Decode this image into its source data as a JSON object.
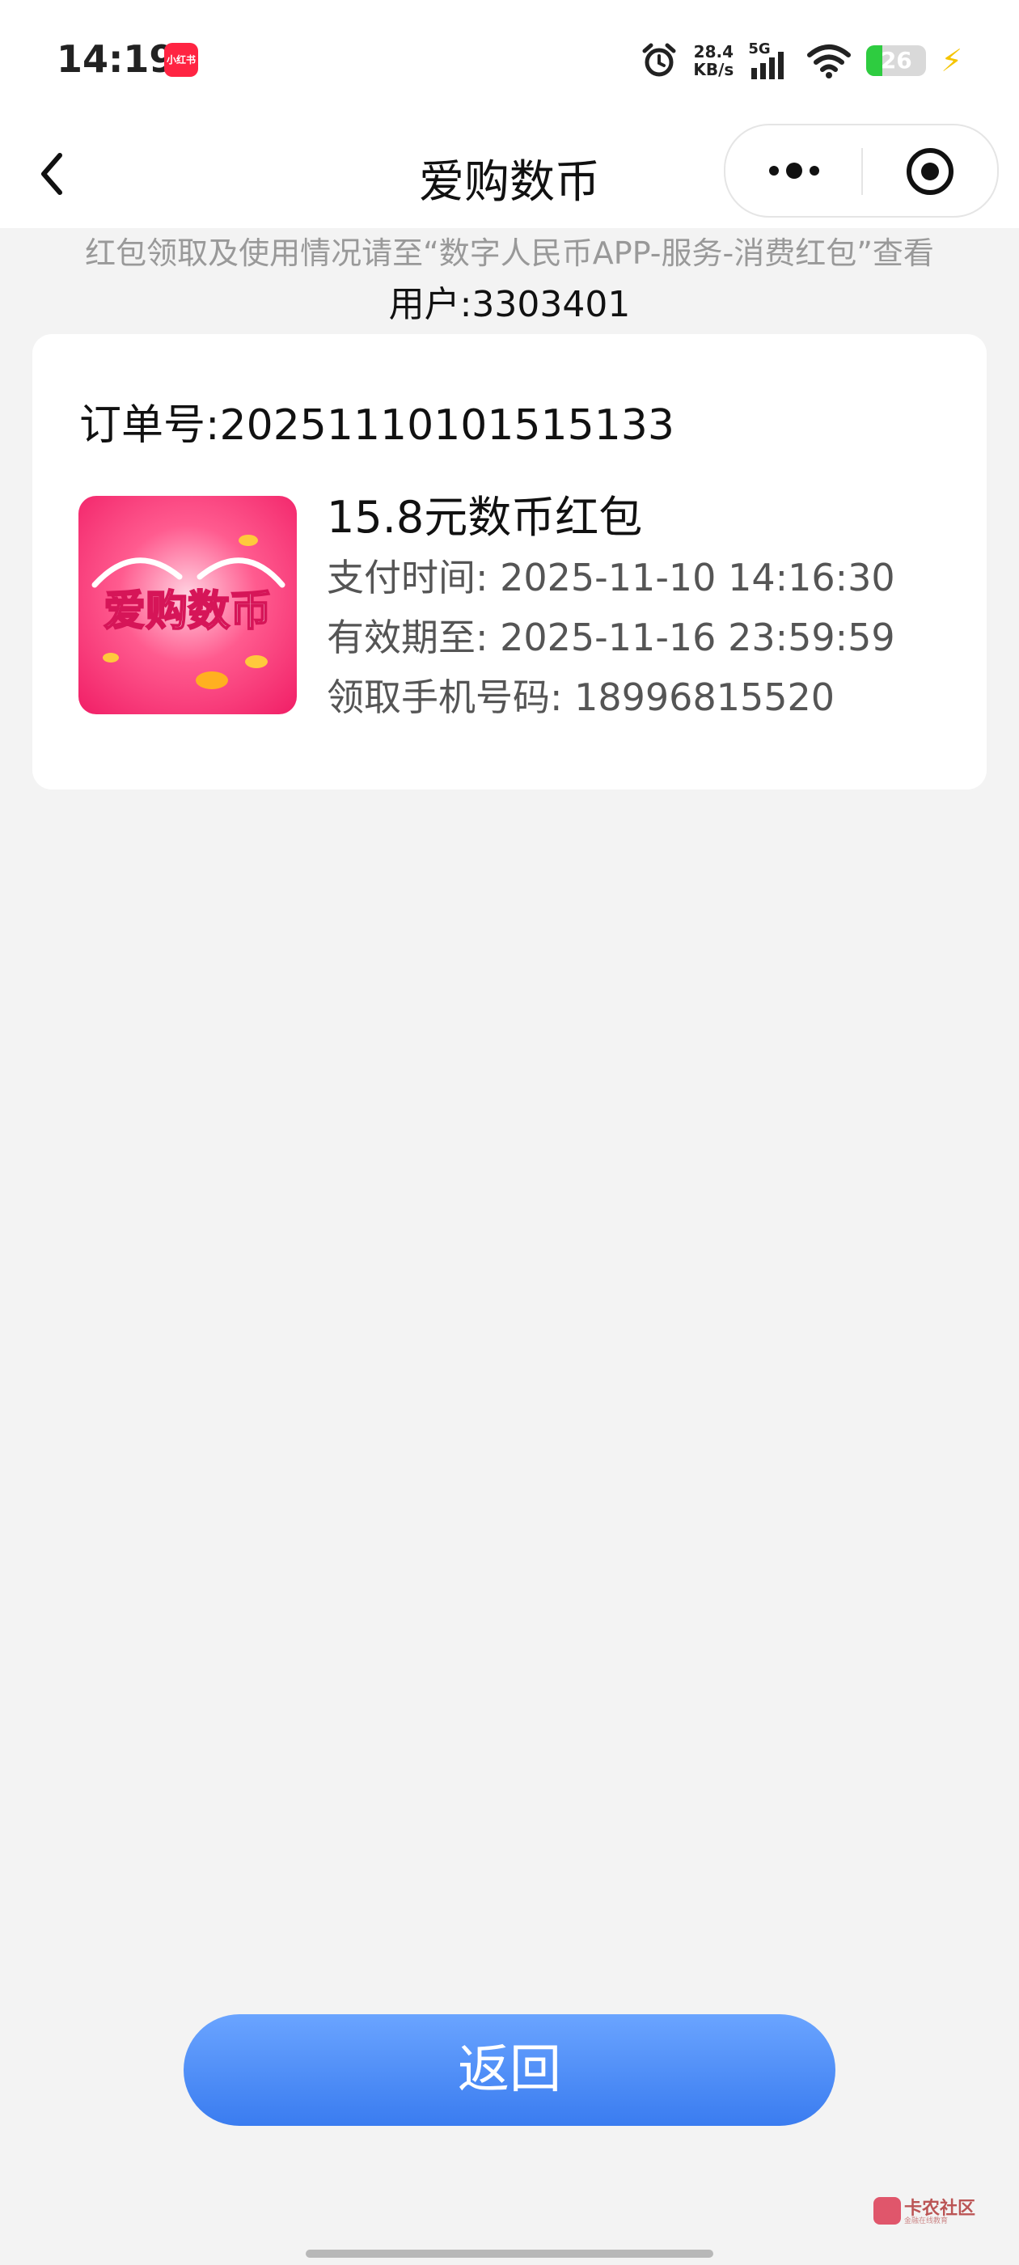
{
  "status_bar": {
    "time": "14:19",
    "app_icon_label": "小红书",
    "net_speed_value": "28.4",
    "net_speed_unit": "KB/s",
    "signal_label": "5G",
    "battery": "26",
    "battery_level": 0.26
  },
  "nav": {
    "title": "爱购数币",
    "back_icon": "chevron-left-icon",
    "more_icon": "more-dots-icon",
    "close_icon": "target-close-icon"
  },
  "notice": "红包领取及使用情况请至“数字人民币APP-服务-消费红包”查看",
  "user": "用户:3303401",
  "order": {
    "order_no": "订单号:20251110101515133",
    "thumbnail_text": "爱购数币",
    "product_name": "15.8元数币红包",
    "pay_time": "支付时间: 2025-11-10 14:16:30",
    "valid_until": "有效期至: 2025-11-16 23:59:59",
    "phone": "领取手机号码: 18996815520"
  },
  "return_button": "返回",
  "watermark": {
    "title": "卡农社区",
    "subtitle": "金融在线教育"
  },
  "colors": {
    "accent_blue": "#3a7cf0",
    "background": "#f3f3f3",
    "thumbnail_pink": "#f0346f"
  }
}
